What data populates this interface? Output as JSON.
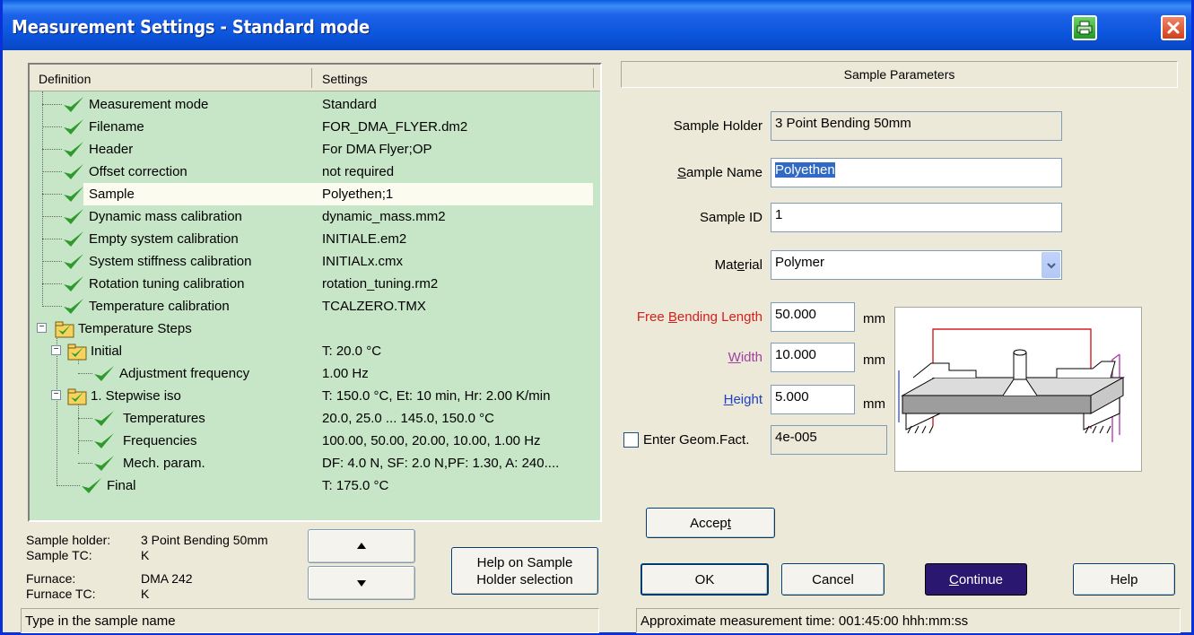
{
  "window": {
    "title": "Measurement Settings - Standard mode",
    "print_icon": "printer-icon",
    "close_icon": "close-icon"
  },
  "tree": {
    "col_definition": "Definition",
    "col_settings": "Settings",
    "rows": [
      {
        "label": "Measurement mode",
        "value": "Standard"
      },
      {
        "label": "Filename",
        "value": "FOR_DMA_FLYER.dm2"
      },
      {
        "label": "Header",
        "value": "For DMA Flyer;OP"
      },
      {
        "label": "Offset correction",
        "value": "not required"
      },
      {
        "label": "Sample",
        "value": "Polyethen;1"
      },
      {
        "label": "Dynamic mass calibration",
        "value": "dynamic_mass.mm2"
      },
      {
        "label": "Empty system calibration",
        "value": "INITIALE.em2"
      },
      {
        "label": "System stiffness calibration",
        "value": "INITIALx.cmx"
      },
      {
        "label": "Rotation tuning calibration",
        "value": "rotation_tuning.rm2"
      },
      {
        "label": "Temperature calibration",
        "value": "TCALZERO.TMX"
      },
      {
        "label": "Temperature Steps",
        "value": ""
      },
      {
        "label": "Initial",
        "value": "T: 20.0 °C"
      },
      {
        "label": "Adjustment frequency",
        "value": "1.00 Hz"
      },
      {
        "label": "1. Stepwise iso",
        "value": "T: 150.0 °C, Et: 10 min, Hr: 2.00 K/min"
      },
      {
        "label": "Temperatures",
        "value": "20.0, 25.0 ... 145.0, 150.0 °C"
      },
      {
        "label": "Frequencies",
        "value": "100.00, 50.00, 20.00, 10.00, 1.00 Hz"
      },
      {
        "label": "Mech. param.",
        "value": "DF: 4.0 N, SF: 2.0 N,PF: 1.30, A: 240...."
      },
      {
        "label": "Final",
        "value": "T: 175.0 °C"
      }
    ]
  },
  "info": {
    "sample_holder_label": "Sample holder:",
    "sample_holder_value": "3 Point Bending 50mm",
    "sample_tc_label": "Sample TC:",
    "sample_tc_value": "K",
    "furnace_label": "Furnace:",
    "furnace_value": "DMA 242",
    "furnace_tc_label": "Furnace TC:",
    "furnace_tc_value": "K"
  },
  "help_holder_line1": "Help on Sample",
  "help_holder_line2": "Holder selection",
  "status_left": "Type in the sample name",
  "status_right": "Approximate measurement time: 001:45:00 hhh:mm:ss",
  "params": {
    "header": "Sample Parameters",
    "sample_holder_label": "Sample Holder",
    "sample_holder_value": "3 Point Bending 50mm",
    "sample_name_label_pre": "",
    "sample_name_label_u": "S",
    "sample_name_label_post": "ample Name",
    "sample_name_value": "Polyethen",
    "sample_id_label": "Sample ID",
    "sample_id_value": "1",
    "material_label_pre": "Mat",
    "material_label_u": "e",
    "material_label_post": "rial",
    "material_value": "Polymer",
    "free_length_label_pre": "Free ",
    "free_length_label_u": "B",
    "free_length_label_post": "ending Length",
    "free_length_value": "50.000",
    "width_label_u": "W",
    "width_label_post": "idth",
    "width_value": "10.000",
    "height_label_u": "H",
    "height_label_post": "eight",
    "height_value": "5.000",
    "unit": "mm",
    "geom_label": "Enter Geom.Fact.",
    "geom_value": "4e-005"
  },
  "buttons": {
    "accept_pre": "Accep",
    "accept_u": "t",
    "ok": "OK",
    "cancel": "Cancel",
    "continue_u": "C",
    "continue_post": "ontinue",
    "help": "Help"
  },
  "colors": {
    "tree_bg": "#c7e6c7",
    "check_green": "#2e9a2e",
    "required_label_red": "#d42020",
    "width_label_magenta": "#a040a0",
    "height_label_blue": "#2040c0",
    "continue_bg": "#2a1870"
  }
}
